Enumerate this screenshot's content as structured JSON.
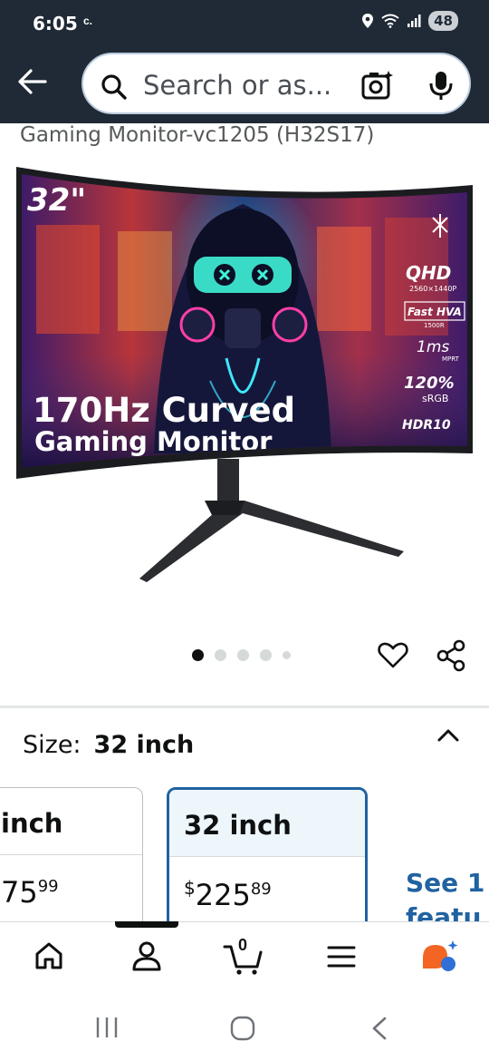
{
  "status_bar": {
    "time": "6:05",
    "carrier_icon": "c-icon",
    "battery": "48",
    "icons": [
      "location-icon",
      "wifi-icon",
      "signal-icon",
      "battery-icon"
    ]
  },
  "search": {
    "placeholder": "Search or as...",
    "icons": [
      "back-arrow-icon",
      "search-icon",
      "camera-icon",
      "microphone-icon"
    ]
  },
  "product": {
    "title": "Gaming Monitor-vc1205 (H32S17)",
    "image": {
      "size_badge": "32\"",
      "headline_1": "170Hz Curved",
      "headline_2": "Gaming Monitor",
      "spec_qhd": "QHD",
      "spec_resolution": "2560×1440P",
      "spec_panel": "Fast HVA",
      "spec_curve": "1500R",
      "spec_response": "1ms",
      "spec_response_sub": "MPRT",
      "spec_gamut": "120%",
      "spec_gamut_sub": "sRGB",
      "spec_hdr": "HDR10"
    },
    "carousel": {
      "count": 5,
      "active": 1
    }
  },
  "size_section": {
    "label": "Size:",
    "value": "32 inch",
    "options": [
      {
        "title": "inch",
        "price_whole": "75",
        "price_frac": "99"
      },
      {
        "title": "32 inch",
        "price_symbol": "$",
        "price_whole": "225",
        "price_frac": "89",
        "selected": true
      }
    ],
    "see_features_line1": "See 1",
    "see_features_line2": "featu"
  },
  "bottom_nav": {
    "items": [
      "home-icon",
      "account-icon",
      "cart-icon",
      "menu-icon",
      "rufus-icon"
    ],
    "cart_count": "0",
    "active": "account-icon"
  },
  "colors": {
    "header_bg": "#1f2a36",
    "link_blue": "#2162a1",
    "selected_bg": "#edf6fb",
    "text": "#0f1111"
  }
}
